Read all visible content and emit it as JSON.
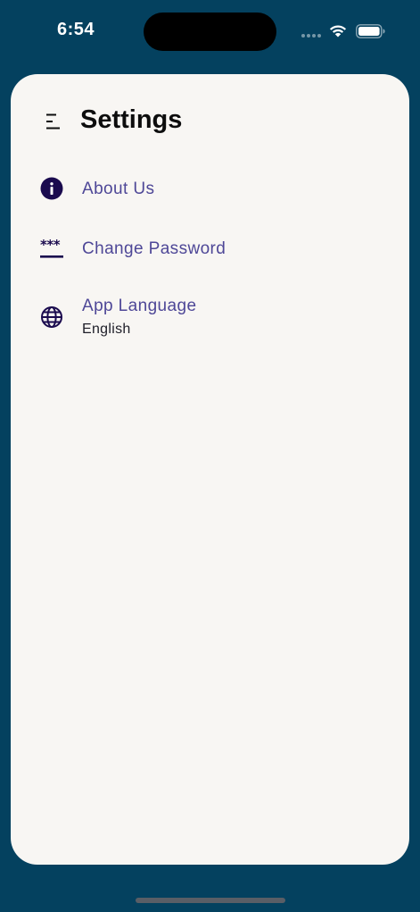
{
  "status_bar": {
    "time": "6:54",
    "icons": [
      "cellular-signal-icon",
      "wifi-icon",
      "battery-icon"
    ]
  },
  "header": {
    "title": "Settings",
    "menu_icon": "menu-icon"
  },
  "settings": {
    "items": [
      {
        "icon": "info-icon",
        "label": "About Us"
      },
      {
        "icon": "password-icon",
        "label": "Change Password"
      },
      {
        "icon": "globe-icon",
        "label": "App Language",
        "value": "English"
      }
    ]
  },
  "colors": {
    "background": "#04415f",
    "card": "#f8f6f3",
    "accent": "#4e4797",
    "icon": "#1a0a4e",
    "title": "#0d0d0d"
  }
}
